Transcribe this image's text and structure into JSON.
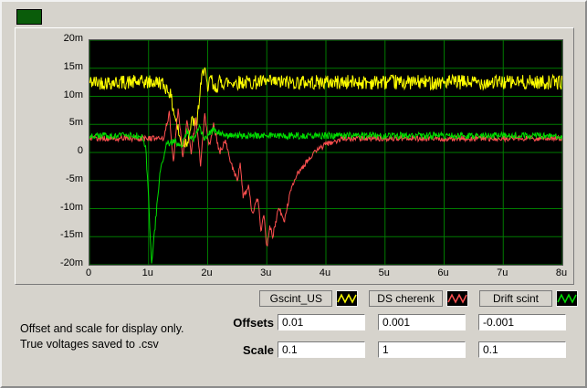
{
  "window": {
    "bg": "#d6d3cc"
  },
  "decoration_color": "#0a5c0a",
  "note": {
    "line1": "Offset and scale for display only.",
    "line2": "True voltages saved to .csv"
  },
  "controls": {
    "offsets_label": "Offsets",
    "scale_label": "Scale",
    "offsets": [
      "0.01",
      "0.001",
      "-0.001"
    ],
    "scale": [
      "0.1",
      "1",
      "0.1"
    ]
  },
  "legend": [
    {
      "label": "Gscint_US",
      "color": "#ffff00"
    },
    {
      "label": "DS cherenk",
      "color": "#ff5050"
    },
    {
      "label": "Drift scint",
      "color": "#00dd00"
    }
  ],
  "chart_data": {
    "type": "line",
    "title": "",
    "xlabel": "",
    "ylabel": "",
    "bg": "#000000",
    "grid": true,
    "grid_color": "#007a00",
    "x_range": [
      0,
      8
    ],
    "y_range": [
      -20,
      20
    ],
    "xticks": [
      "0",
      "1u",
      "2u",
      "3u",
      "4u",
      "5u",
      "6u",
      "7u",
      "8u"
    ],
    "yticks": [
      "20m",
      "15m",
      "10m",
      "5m",
      "0",
      "-5m",
      "-10m",
      "-15m",
      "-20m"
    ],
    "x_unit": "u (microseconds)",
    "y_unit": "m (millivolts)",
    "series": [
      {
        "name": "Gscint_US",
        "color": "#ffff00",
        "noise": 1.3,
        "points": [
          [
            0,
            12.5
          ],
          [
            1.2,
            12.5
          ],
          [
            1.35,
            11
          ],
          [
            1.5,
            4
          ],
          [
            1.55,
            1.5
          ],
          [
            1.65,
            2
          ],
          [
            1.75,
            6
          ],
          [
            1.8,
            4
          ],
          [
            1.9,
            13
          ],
          [
            1.95,
            16
          ],
          [
            2.0,
            10
          ],
          [
            2.05,
            14
          ],
          [
            2.1,
            11
          ],
          [
            2.2,
            12.5
          ],
          [
            8,
            12.5
          ]
        ]
      },
      {
        "name": "DS cherenk",
        "color": "#ff5050",
        "noise": 0.5,
        "points": [
          [
            0,
            2.5
          ],
          [
            1.25,
            2.5
          ],
          [
            1.35,
            7
          ],
          [
            1.42,
            -2
          ],
          [
            1.5,
            8
          ],
          [
            1.58,
            -1
          ],
          [
            1.65,
            6
          ],
          [
            1.72,
            0
          ],
          [
            1.8,
            6
          ],
          [
            1.88,
            -2
          ],
          [
            1.95,
            7
          ],
          [
            2.02,
            1
          ],
          [
            2.1,
            5
          ],
          [
            2.2,
            0
          ],
          [
            2.3,
            2
          ],
          [
            2.4,
            -2
          ],
          [
            2.5,
            -5
          ],
          [
            2.55,
            -2
          ],
          [
            2.6,
            -8
          ],
          [
            2.7,
            -6
          ],
          [
            2.75,
            -11
          ],
          [
            2.85,
            -8
          ],
          [
            2.9,
            -14
          ],
          [
            2.95,
            -11
          ],
          [
            3.0,
            -17
          ],
          [
            3.05,
            -13
          ],
          [
            3.1,
            -15
          ],
          [
            3.2,
            -10
          ],
          [
            3.3,
            -12
          ],
          [
            3.4,
            -7
          ],
          [
            3.5,
            -4
          ],
          [
            3.65,
            -2
          ],
          [
            3.8,
            0
          ],
          [
            4.0,
            1.5
          ],
          [
            4.3,
            2.5
          ],
          [
            8,
            2.5
          ]
        ]
      },
      {
        "name": "Drift scint",
        "color": "#00dd00",
        "noise": 0.6,
        "points": [
          [
            0,
            3
          ],
          [
            0.88,
            3
          ],
          [
            0.95,
            1
          ],
          [
            1.0,
            -8
          ],
          [
            1.05,
            -20
          ],
          [
            1.12,
            -12
          ],
          [
            1.2,
            -3
          ],
          [
            1.3,
            1.5
          ],
          [
            1.45,
            2
          ],
          [
            1.55,
            1
          ],
          [
            1.65,
            4
          ],
          [
            1.75,
            2
          ],
          [
            1.85,
            4.5
          ],
          [
            1.95,
            2.5
          ],
          [
            2.1,
            4
          ],
          [
            2.3,
            3
          ],
          [
            8,
            3
          ]
        ]
      }
    ]
  }
}
